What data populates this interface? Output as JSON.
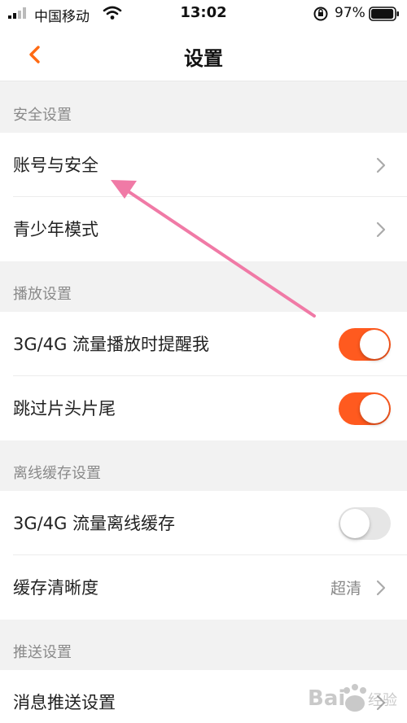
{
  "status_bar": {
    "carrier": "中国移动",
    "time": "13:02",
    "battery_percent": "97%",
    "battery_level": 0.97,
    "icons": [
      "signal-icon",
      "wifi-icon",
      "orientation-lock-icon",
      "battery-icon"
    ]
  },
  "nav": {
    "title": "设置",
    "back_icon": "chevron-left-icon",
    "accent_color": "#ff6a13"
  },
  "sections": {
    "security": {
      "header": "安全设置",
      "items": [
        {
          "label": "账号与安全"
        },
        {
          "label": "青少年模式"
        }
      ]
    },
    "playback": {
      "header": "播放设置",
      "items": [
        {
          "label": "3G/4G 流量播放时提醒我",
          "toggle": true
        },
        {
          "label": "跳过片头片尾",
          "toggle": true
        }
      ]
    },
    "offline": {
      "header": "离线缓存设置",
      "items": [
        {
          "label": "3G/4G 流量离线缓存",
          "toggle": false
        },
        {
          "label": "缓存清晰度",
          "value": "超清"
        }
      ]
    },
    "push": {
      "header": "推送设置",
      "items": [
        {
          "label": "消息推送设置"
        }
      ]
    }
  },
  "colors": {
    "toggle_on": "#ff5a1f",
    "toggle_off": "#e6e6e6",
    "annotation_arrow": "#f07aa6",
    "page_background": "#f2f2f2"
  },
  "watermark": {
    "text": "Bai 经验"
  }
}
